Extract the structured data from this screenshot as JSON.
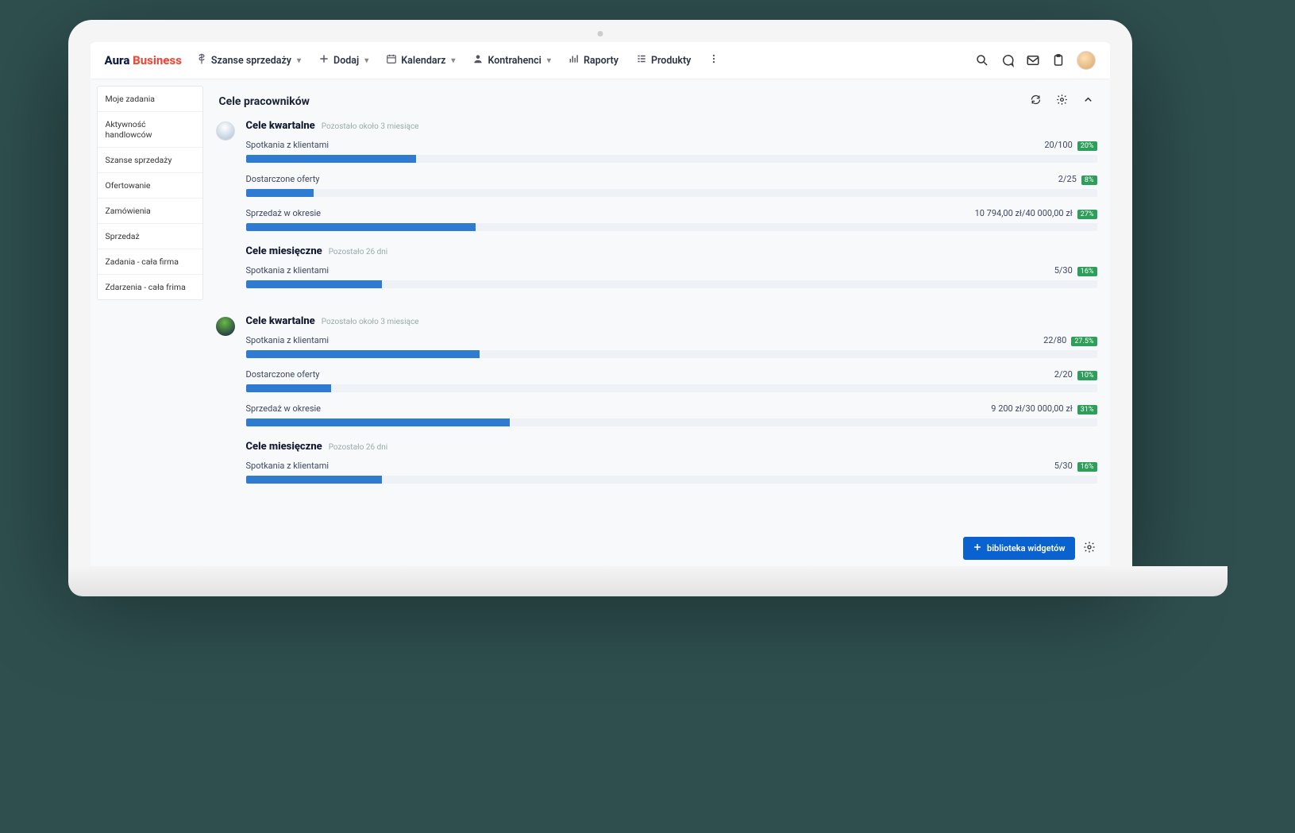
{
  "logo": {
    "part1": "Aura",
    "part2": "Business"
  },
  "nav": {
    "szanse": "Szanse sprzedaży",
    "dodaj": "Dodaj",
    "kalendarz": "Kalendarz",
    "kontrahenci": "Kontrahenci",
    "raporty": "Raporty",
    "produkty": "Produkty"
  },
  "sidebar": {
    "items": [
      "Moje zadania",
      "Aktywność handlowców",
      "Szanse sprzedaży",
      "Ofertowanie",
      "Zamówienia",
      "Sprzedaż",
      "Zadania - cała firma",
      "Zdarzenia - cała frima"
    ]
  },
  "panel": {
    "title": "Cele pracowników"
  },
  "widget_btn": "biblioteka widgetów",
  "chart_data": [
    {
      "type": "bar",
      "title": "Cele kwartalne",
      "subtitle": "Pozostało około 3 miesiące",
      "series": [
        {
          "name": "Spotkania z klientami",
          "value_label": "20/100",
          "pct_label": "20%",
          "pct": 20
        },
        {
          "name": "Dostarczone oferty",
          "value_label": "2/25",
          "pct_label": "8%",
          "pct": 8
        },
        {
          "name": "Sprzedaż w okresie",
          "value_label": "10 794,00 zł/40 000,00 zł",
          "pct_label": "27%",
          "pct": 27
        }
      ]
    },
    {
      "type": "bar",
      "title": "Cele miesięczne",
      "subtitle": "Pozostało 26 dni",
      "series": [
        {
          "name": "Spotkania z klientami",
          "value_label": "5/30",
          "pct_label": "16%",
          "pct": 16
        }
      ]
    },
    {
      "type": "bar",
      "title": "Cele kwartalne",
      "subtitle": "Pozostało około 3 miesiące",
      "series": [
        {
          "name": "Spotkania z klientami",
          "value_label": "22/80",
          "pct_label": "27.5%",
          "pct": 27.5
        },
        {
          "name": "Dostarczone oferty",
          "value_label": "2/20",
          "pct_label": "10%",
          "pct": 10
        },
        {
          "name": "Sprzedaż w okresie",
          "value_label": "9 200 zł/30 000,00 zł",
          "pct_label": "31%",
          "pct": 31
        }
      ]
    },
    {
      "type": "bar",
      "title": "Cele miesięczne",
      "subtitle": "Pozostało 26 dni",
      "series": [
        {
          "name": "Spotkania z klientami",
          "value_label": "5/30",
          "pct_label": "16%",
          "pct": 16
        }
      ]
    }
  ]
}
